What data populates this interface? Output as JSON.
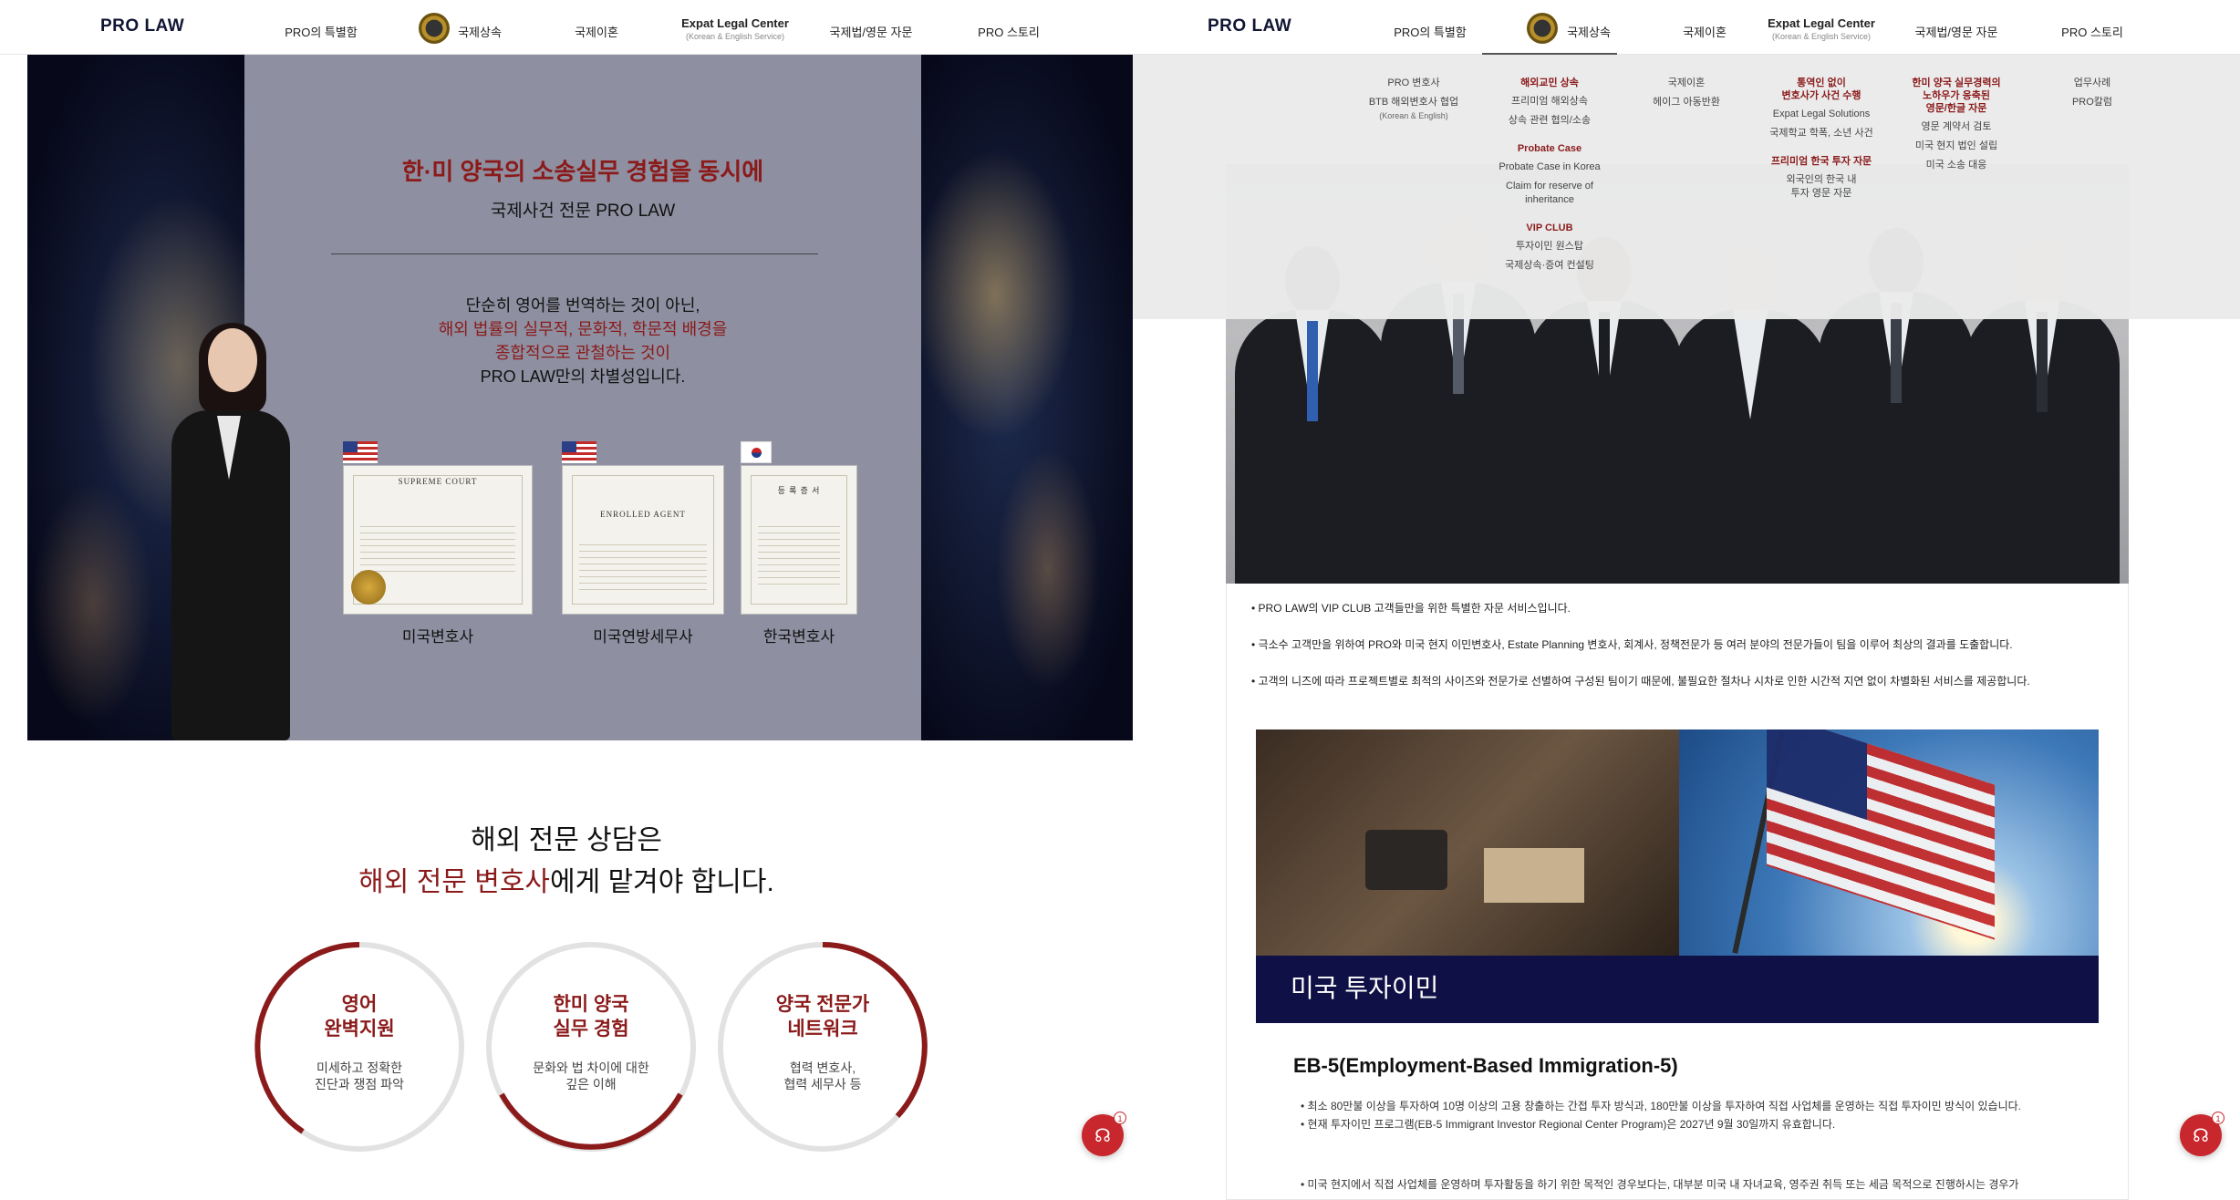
{
  "left": {
    "nav": {
      "logo": "PRO LAW",
      "items": [
        "PRO의 특별함",
        "국제상속",
        "국제이혼",
        "국제법/영문 자문",
        "PRO 스토리"
      ],
      "expat_title": "Expat Legal Center",
      "expat_sub": "(Korean & English Service)"
    },
    "hero": {
      "title": "한·미 양국의 소송실무 경험을 동시에",
      "subtitle": "국제사건 전문 PRO LAW",
      "body_line1": "단순히 영어를 번역하는 것이 아닌,",
      "body_line2": "해외 법률의 실무적, 문화적, 학문적 배경을",
      "body_line3": "종합적으로 관철하는 것이",
      "body_line4": "PRO LAW만의 차별성입니다.",
      "cert1_caps": "SUPREME COURT",
      "cert2_caps": "ENROLLED AGENT",
      "cert3_caps": "등 록 증 서",
      "cert_labels": [
        "미국변호사",
        "미국연방세무사",
        "한국변호사"
      ]
    },
    "section2": {
      "line1": "해외 전문 상담은",
      "line2_red": "해외 전문 변호사",
      "line2_rest": "에게 맡겨야 합니다."
    },
    "circles": [
      {
        "title1": "영어",
        "title2": "완벽지원",
        "desc1": "미세하고 정확한",
        "desc2": "진단과 쟁점 파악"
      },
      {
        "title1": "한미 양국",
        "title2": "실무 경험",
        "desc1": "문화와 법 차이에 대한",
        "desc2": "깊은 이해"
      },
      {
        "title1": "양국 전문가",
        "title2": "네트워크",
        "desc1": "협력 변호사,",
        "desc2": "협력 세무사 등"
      }
    ],
    "fab_badge": "1",
    "colors": {
      "brand_red": "#8b1a1a",
      "navy": "#101533",
      "fab_red": "#c8272d"
    }
  },
  "right": {
    "nav": {
      "logo": "PRO LAW",
      "items": [
        "PRO의 특별함",
        "국제상속",
        "국제이혼",
        "국제법/영문 자문",
        "PRO 스토리"
      ],
      "expat_title": "Expat Legal Center",
      "expat_sub": "(Korean & English Service)"
    },
    "mega": {
      "col1": [
        "PRO 변호사",
        "BTB 해외변호사 협업",
        "(Korean & English)"
      ],
      "col2_head1": "해외교민 상속",
      "col2_items1": [
        "프리미엄 해외상속",
        "상속 관련 협의/소송"
      ],
      "col2_head2": "Probate Case",
      "col2_items2": [
        "Probate Case in Korea",
        "Claim for reserve of",
        "inheritance"
      ],
      "col2_head3": "VIP CLUB",
      "col2_items3": [
        "투자이민 원스탑",
        "국제상속·증여 컨설팅"
      ],
      "col3": [
        "국제이혼",
        "헤이그 아동반환"
      ],
      "col4_head1a": "통역인 없이",
      "col4_head1b": "변호사가 사건 수행",
      "col4_items1": [
        "Expat Legal Solutions",
        "국제학교 학폭, 소년 사건"
      ],
      "col4_head2": "프리미엄 한국 투자 자문",
      "col4_items2": [
        "외국인의 한국 내",
        "투자 영문 자문"
      ],
      "col5_head_a": "한미 양국 실무경력의",
      "col5_head_b": "노하우가 응축된",
      "col5_head_c": "영문/한글 자문",
      "col5_items": [
        "영문 계약서 검토",
        "미국 현지 법인 설립",
        "미국 소송 대응"
      ],
      "col6": [
        "업무사례",
        "PRO칼럼"
      ]
    },
    "vip_lines": [
      "• PRO LAW의 VIP CLUB 고객들만을 위한 특별한 자문 서비스입니다.",
      "• 극소수 고객만을 위하여 PRO와 미국 현지 이민변호사, Estate Planning 변호사, 회계사, 정책전문가 등 여러 분야의 전문가들이 팀을 이루어 최상의 결과를 도출합니다.",
      "• 고객의 니즈에 따라 프로젝트별로 최적의 사이즈와 전문가로 선별하여 구성된 팀이기 때문에, 불필요한 절차나 시차로 인한 시간적 지연 없이 차별화된 서비스를 제공합니다."
    ],
    "banner_title": "미국 투자이민",
    "eb5_title": "EB-5(Employment-Based Immigration-5)",
    "eb5_lines": [
      "• 최소 80만불 이상을 투자하여 10명 이상의 고용 창출하는 간접 투자 방식과, 180만불 이상을 투자하여 직접 사업체를 운영하는 직접 투자이민 방식이 있습니다.",
      "• 현재 투자이민 프로그램(EB-5 Immigrant Investor Regional Center Program)은 2027년 9월 30일까지 유효합니다.",
      "• 미국 현지에서 직접 사업체를 운영하며 투자활동을 하기 위한 목적인 경우보다는, 대부분 미국 내 자녀교육, 영주권 취득 또는 세금 목적으로 진행하시는 경우가"
    ],
    "fab_badge": "1"
  }
}
